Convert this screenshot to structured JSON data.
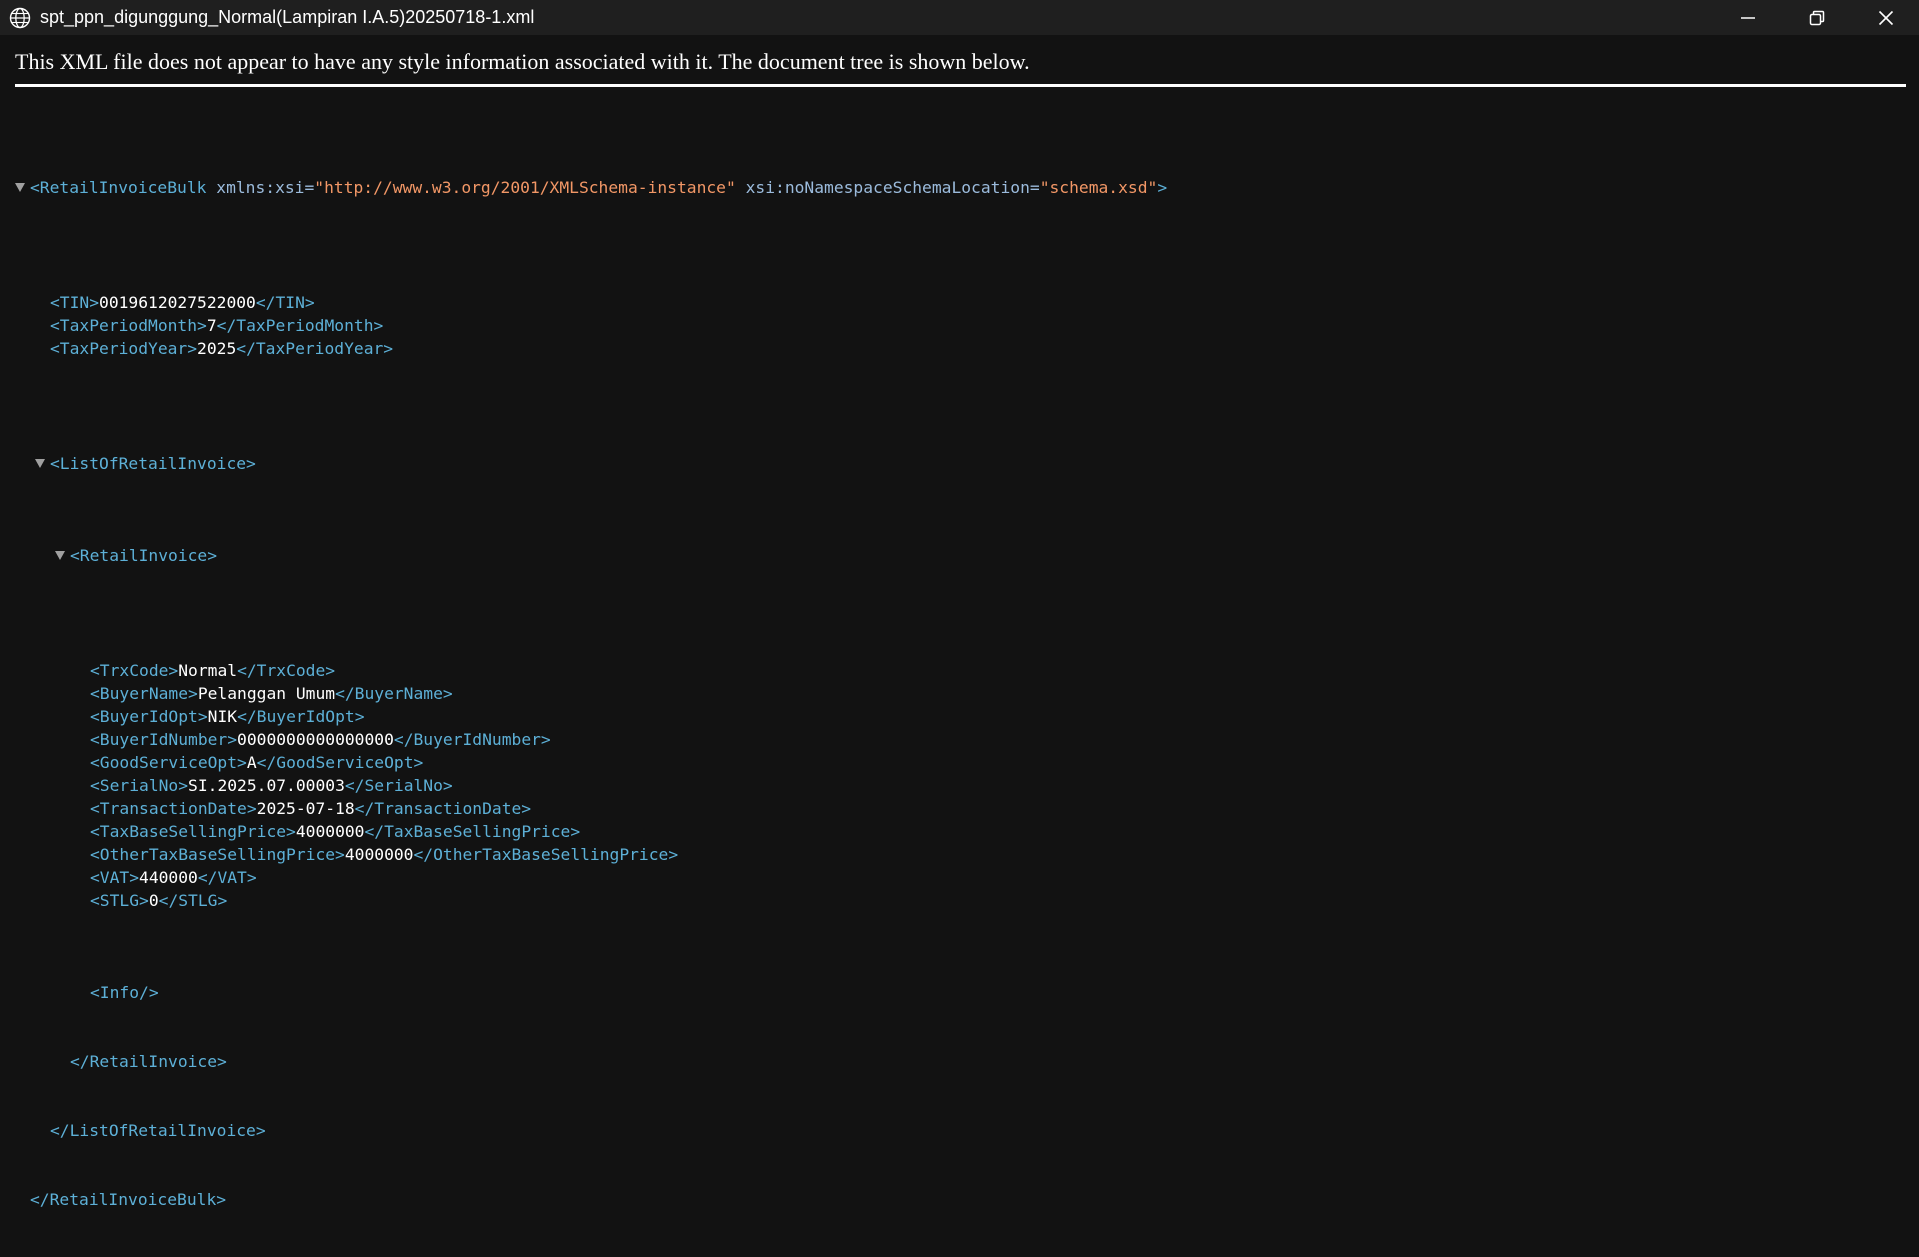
{
  "window": {
    "title": "spt_ppn_digunggung_Normal(Lampiran I.A.5)20250718-1.xml",
    "icons": [
      "globe-icon",
      "minimize-icon",
      "restore-icon",
      "close-icon"
    ]
  },
  "notice": "This XML file does not appear to have any style information associated with it. The document tree is shown below.",
  "xml": {
    "root_open": "<RetailInvoiceBulk",
    "attr1_name": "xmlns:xsi=",
    "attr1_value": "\"http://www.w3.org/2001/XMLSchema-instance\"",
    "attr2_name": "xsi:noNamespaceSchemaLocation=",
    "attr2_value": "\"schema.xsd\"",
    "root_open_end": ">",
    "root_close": "</RetailInvoiceBulk>",
    "list_open": "<ListOfRetailInvoice>",
    "list_close": "</ListOfRetailInvoice>",
    "invoice_open": "<RetailInvoice>",
    "invoice_close": "</RetailInvoice>",
    "info": "<Info/>",
    "header_elements": [
      {
        "name": "TIN",
        "value": "0019612027522000"
      },
      {
        "name": "TaxPeriodMonth",
        "value": "7"
      },
      {
        "name": "TaxPeriodYear",
        "value": "2025"
      }
    ],
    "invoice_elements": [
      {
        "name": "TrxCode",
        "value": "Normal"
      },
      {
        "name": "BuyerName",
        "value": "Pelanggan Umum"
      },
      {
        "name": "BuyerIdOpt",
        "value": "NIK"
      },
      {
        "name": "BuyerIdNumber",
        "value": "0000000000000000"
      },
      {
        "name": "GoodServiceOpt",
        "value": "A"
      },
      {
        "name": "SerialNo",
        "value": "SI.2025.07.00003"
      },
      {
        "name": "TransactionDate",
        "value": "2025-07-18"
      },
      {
        "name": "TaxBaseSellingPrice",
        "value": "4000000"
      },
      {
        "name": "OtherTaxBaseSellingPrice",
        "value": "4000000"
      },
      {
        "name": "VAT",
        "value": "440000"
      },
      {
        "name": "STLG",
        "value": "0"
      }
    ]
  }
}
